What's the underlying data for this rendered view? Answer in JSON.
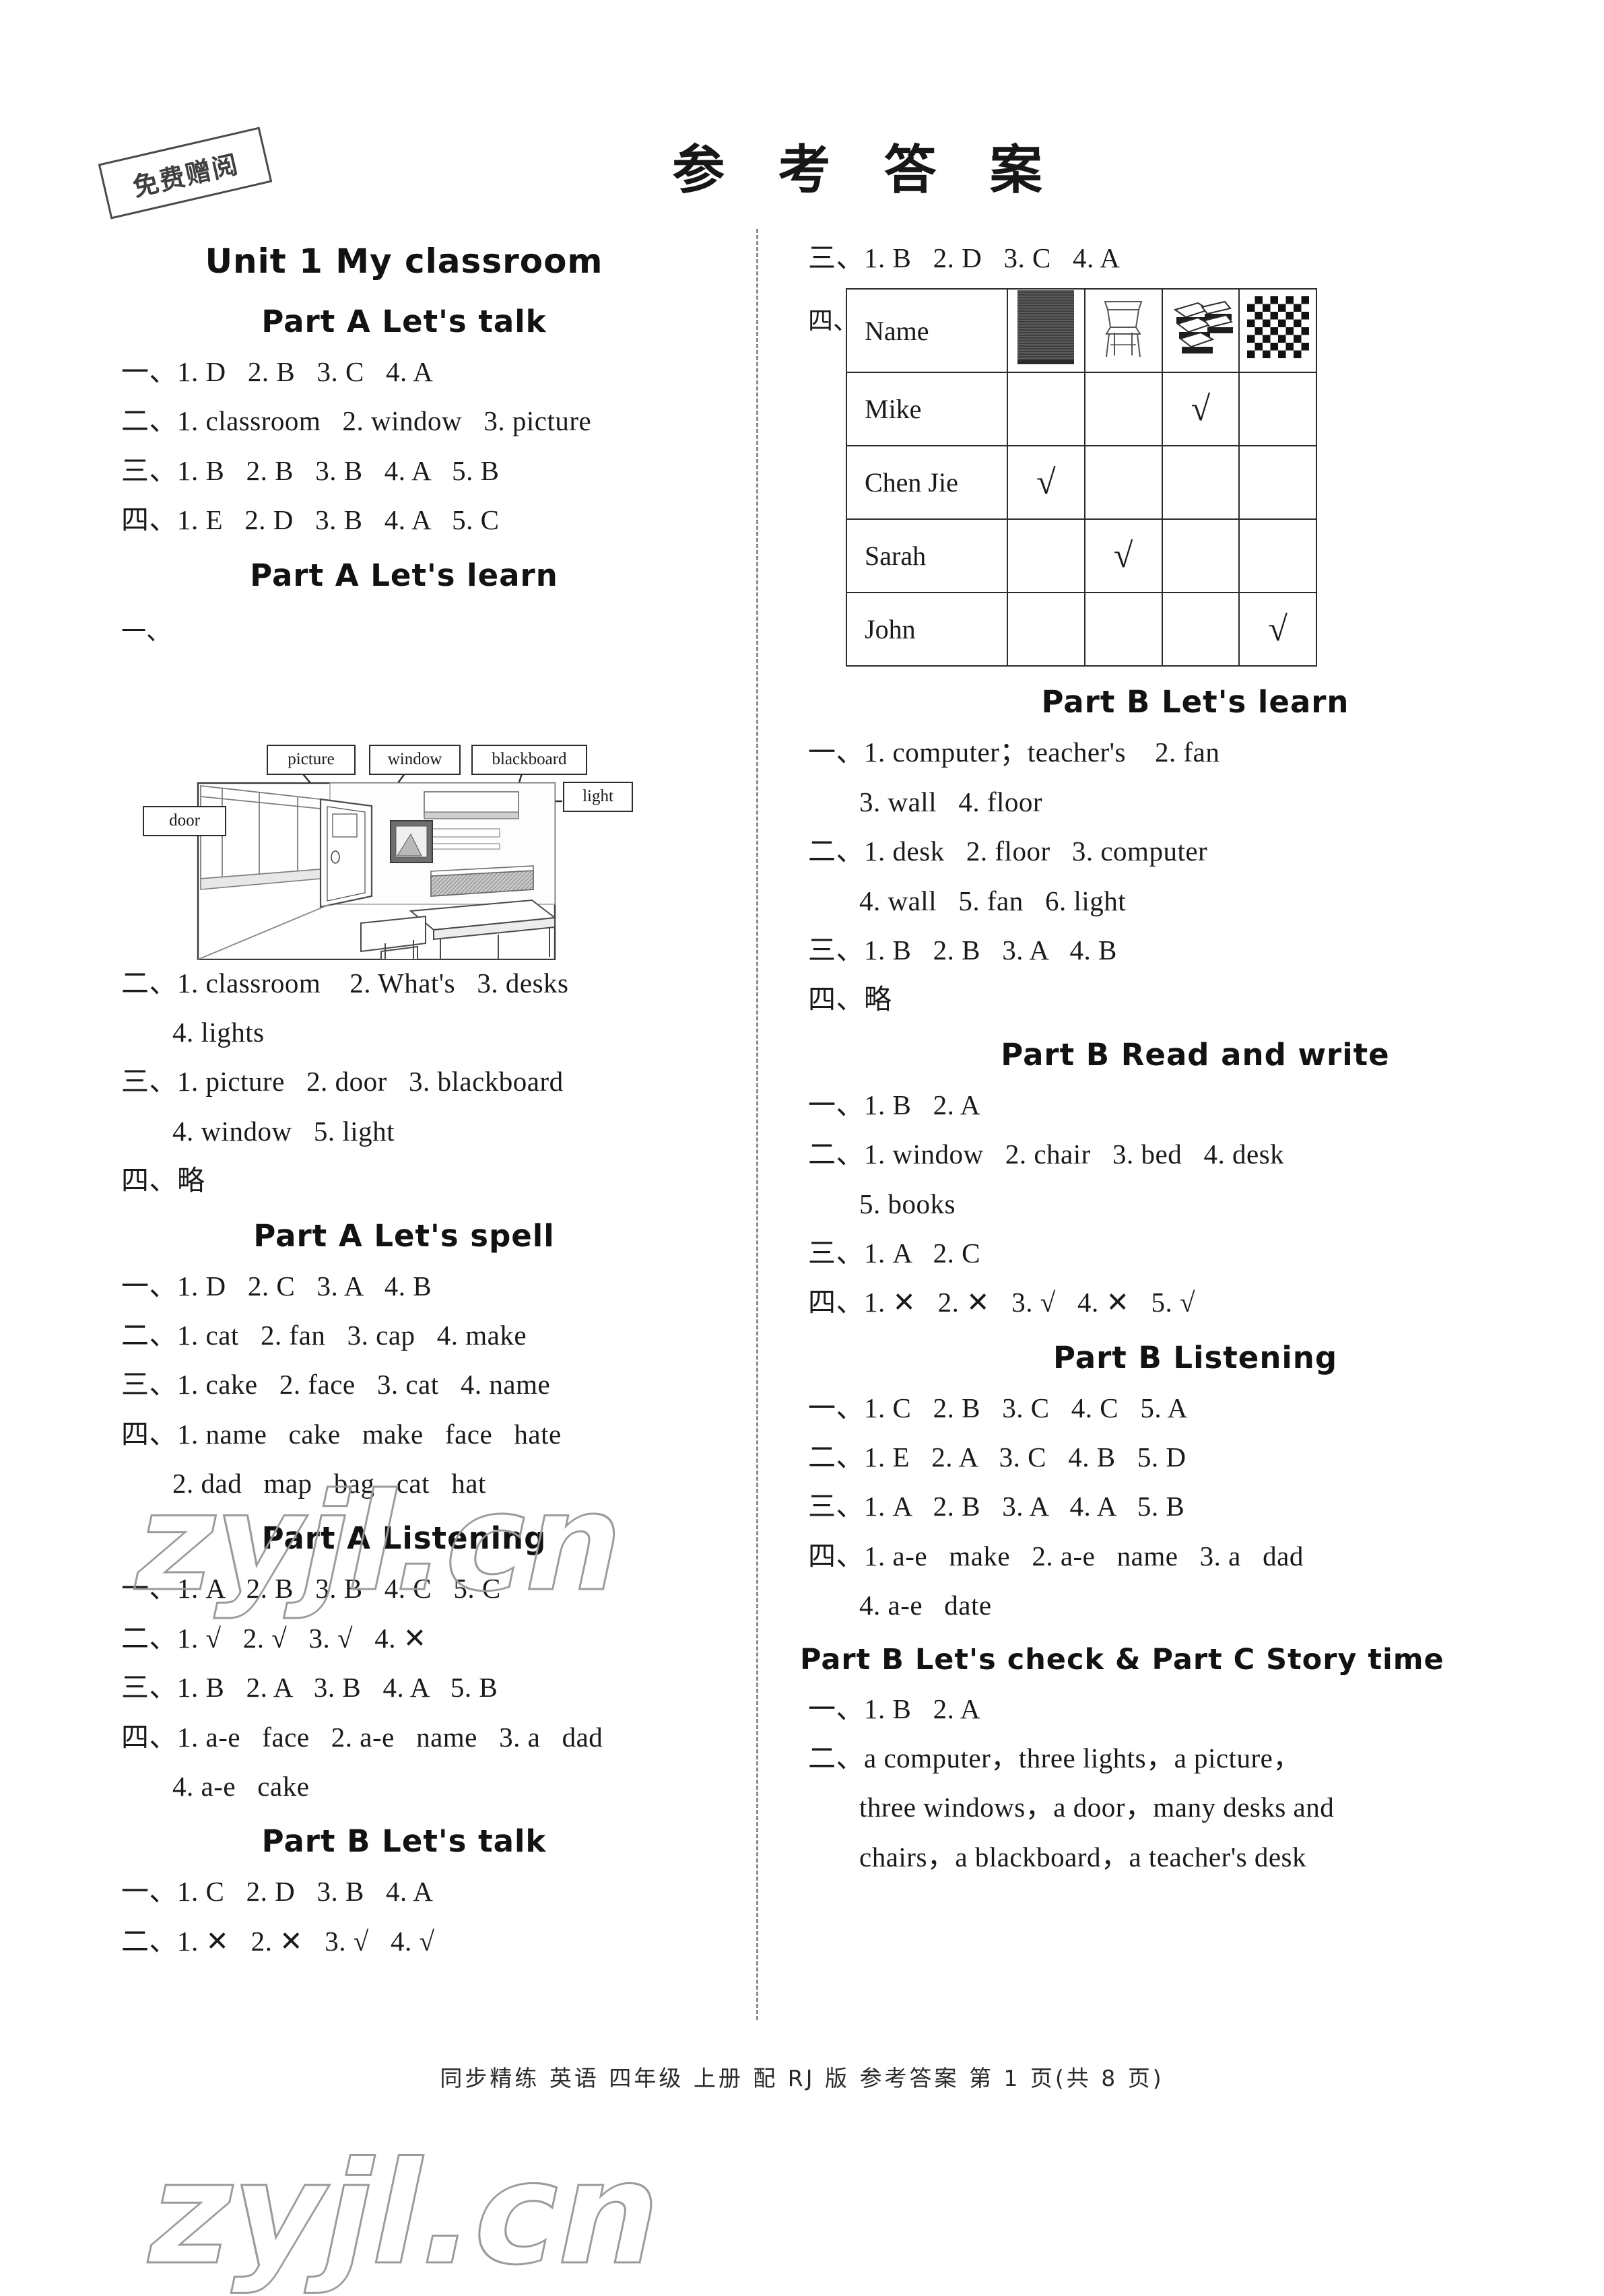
{
  "stamp": {
    "text": "免费赠阅"
  },
  "page_title": "参 考 答 案",
  "watermark": {
    "text": "zyjl.cn"
  },
  "footer": {
    "text": "同步精练  英语  四年级  上册  配 RJ 版  参考答案  第 1 页(共 8 页)"
  },
  "left_column": {
    "unit_title": "Unit 1    My classroom",
    "sections": [
      {
        "heading": "Part A    Let's talk",
        "lines": [
          "一、1. D   2. B   3. C   4. A",
          "二、1. classroom   2. window   3. picture",
          "三、1. B   2. B   3. B   4. A   5. B",
          "四、1. E   2. D   3. B   4. A   5. C"
        ]
      },
      {
        "heading": "Part A    Let's learn",
        "marker": "一、",
        "diagram": {
          "labels": [
            "picture",
            "window",
            "blackboard",
            "light",
            "door"
          ]
        },
        "lines": [
          "二、1. classroom    2. What's   3. desks",
          "4. lights",
          "三、1. picture   2. door   3. blackboard",
          "4. window   5. light",
          "四、略"
        ]
      },
      {
        "heading": "Part A    Let's spell",
        "lines": [
          "一、1. D   2. C   3. A   4. B",
          "二、1. cat   2. fan   3. cap   4. make",
          "三、1. cake   2. face   3. cat   4. name",
          "四、1. name   cake   make   face   hate",
          "2. dad   map   bag   cat   hat"
        ]
      },
      {
        "heading": "Part A    Listening",
        "lines": [
          "一、1. A   2. B   3. B   4. C   5. C",
          "二、1. √   2. √   3. √   4. ✕",
          "三、1. B   2. A   3. B   4. A   5. B",
          "四、1. a-e   face   2. a-e   name   3. a   dad",
          "4. a-e   cake"
        ]
      },
      {
        "heading": "Part B    Let's talk",
        "lines": [
          "一、1. C   2. D   3. B   4. A",
          "二、1. ✕   2. ✕   3. √   4. √"
        ]
      }
    ]
  },
  "right_column": {
    "top_lines": [
      "三、1. B   2. D   3. C   4. A"
    ],
    "table_marker": "四、",
    "table": {
      "columns": [
        "Name",
        "blackboard-icon",
        "chair-icon",
        "desks-icon",
        "floor-icon"
      ],
      "rows": [
        {
          "name": "Mike",
          "ticks": [
            "",
            "",
            "√",
            ""
          ]
        },
        {
          "name": "Chen Jie",
          "ticks": [
            "√",
            "",
            "",
            ""
          ]
        },
        {
          "name": "Sarah",
          "ticks": [
            "",
            "√",
            "",
            ""
          ]
        },
        {
          "name": "John",
          "ticks": [
            "",
            "",
            "",
            "√"
          ]
        }
      ]
    },
    "sections": [
      {
        "heading": "Part B    Let's learn",
        "lines": [
          "一、1. computer；teacher's    2. fan",
          "3. wall   4. floor",
          "二、1. desk   2. floor   3. computer",
          "4. wall   5. fan   6. light",
          "三、1. B   2. B   3. A   4. B",
          "四、略"
        ]
      },
      {
        "heading": "Part B    Read and write",
        "lines": [
          "一、1. B   2. A",
          "二、1. window   2. chair   3. bed   4. desk",
          "5. books",
          "三、1. A   2. C",
          "四、1. ✕   2. ✕   3. √   4. ✕   5. √"
        ]
      },
      {
        "heading": "Part B    Listening",
        "lines": [
          "一、1. C   2. B   3. C   4. C   5. A",
          "二、1. E   2. A   3. C   4. B   5. D",
          "三、1. A   2. B   3. A   4. A   5. B",
          "四、1. a-e   make   2. a-e   name   3. a   dad",
          "4. a-e   date"
        ]
      },
      {
        "heading": "Part B  Let's check & Part C  Story time",
        "lines": [
          "一、1. B   2. A",
          "二、a computer，three lights，a picture，",
          "three windows，a door，many desks and",
          "chairs，a blackboard，a teacher's desk"
        ]
      }
    ]
  }
}
